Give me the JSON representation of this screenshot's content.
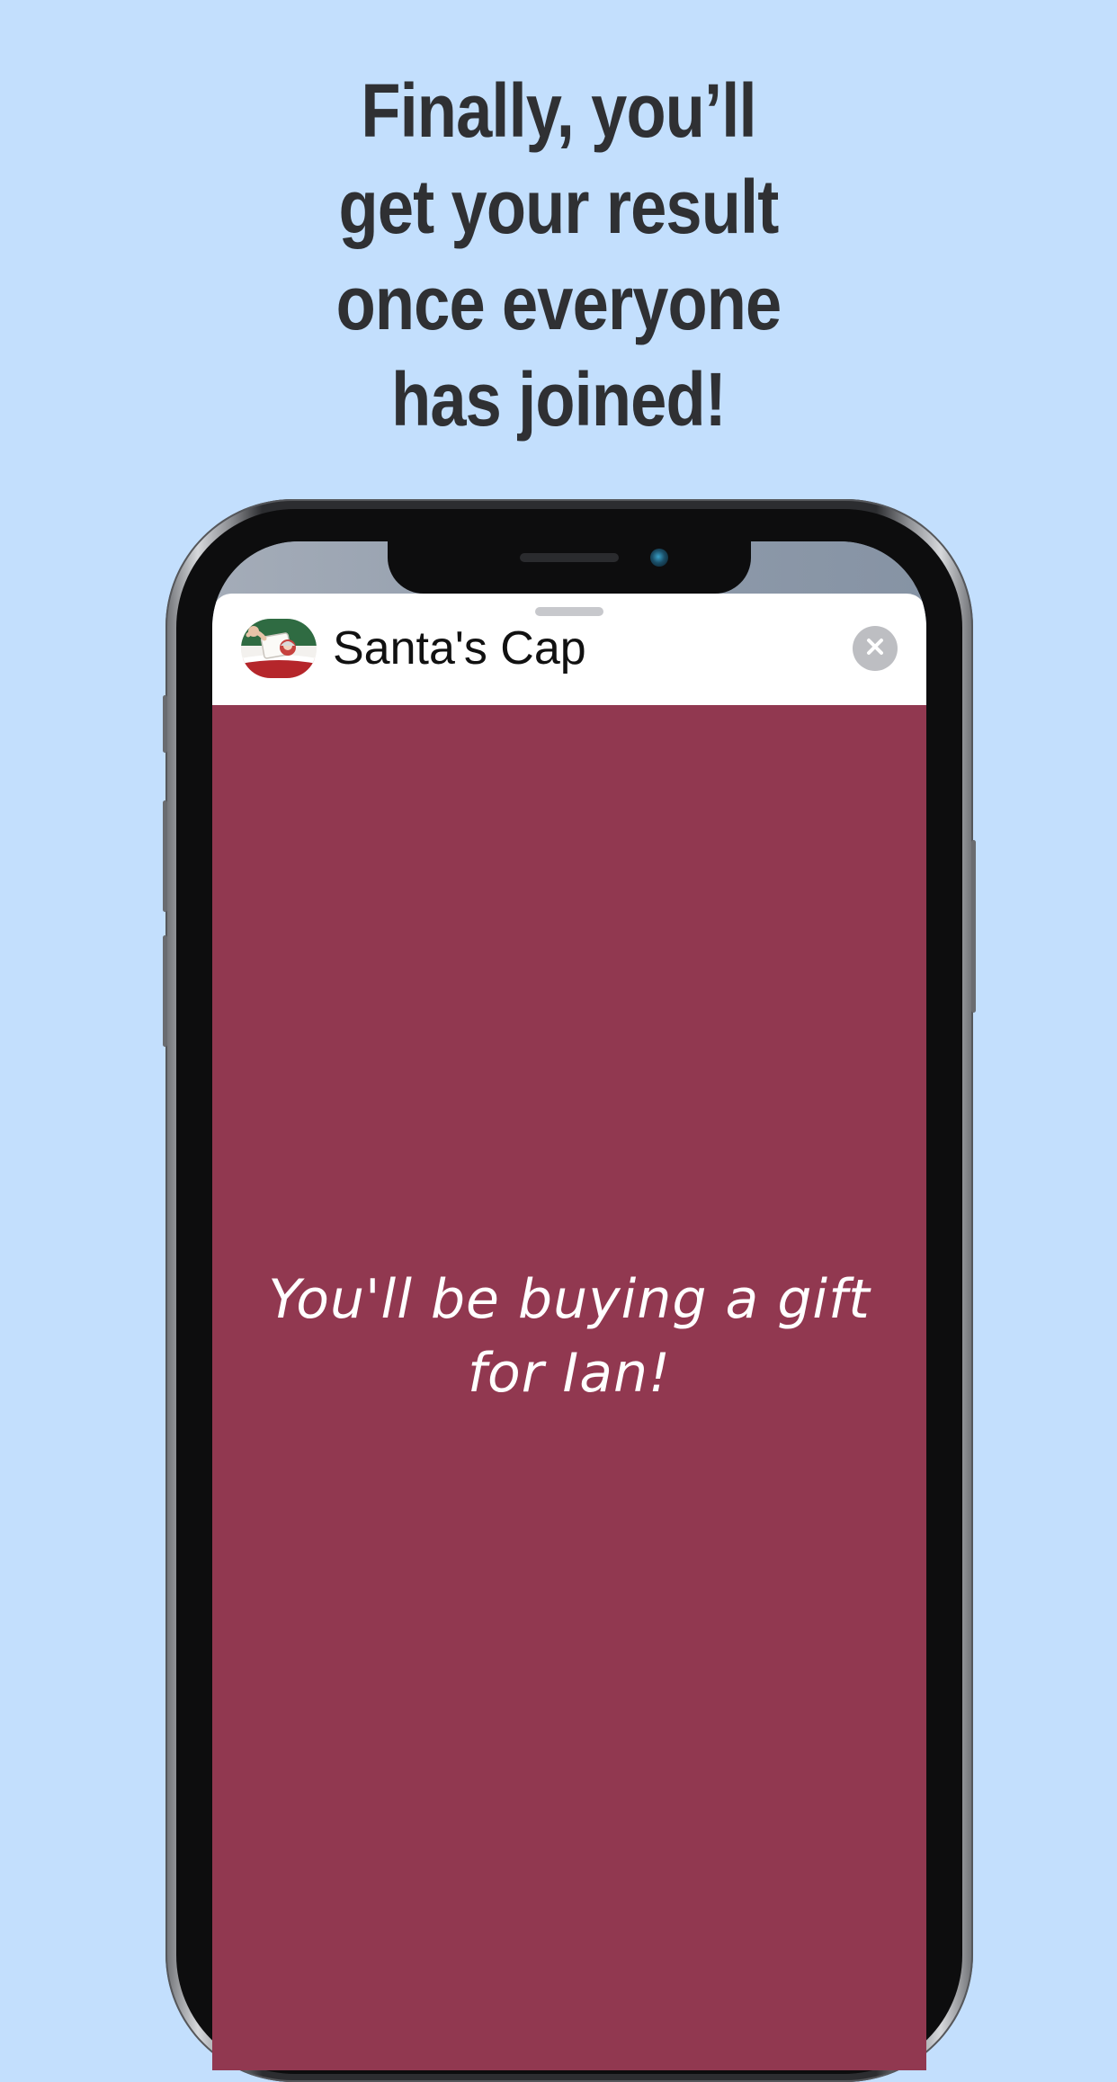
{
  "promo": {
    "headline_lines": [
      "Finally, you’ll",
      "get your result",
      "once everyone",
      "has joined!"
    ]
  },
  "app_sheet": {
    "title": "Santa's Cap",
    "app_icon": "santas-cap-app-icon",
    "close_icon": "close-icon",
    "result_message": "You'll be buying a gift for Ian!"
  },
  "colors": {
    "background": "#c3dffd",
    "content_background": "#913850",
    "headline_text": "#2f3033",
    "close_button": "#bdbec2"
  }
}
